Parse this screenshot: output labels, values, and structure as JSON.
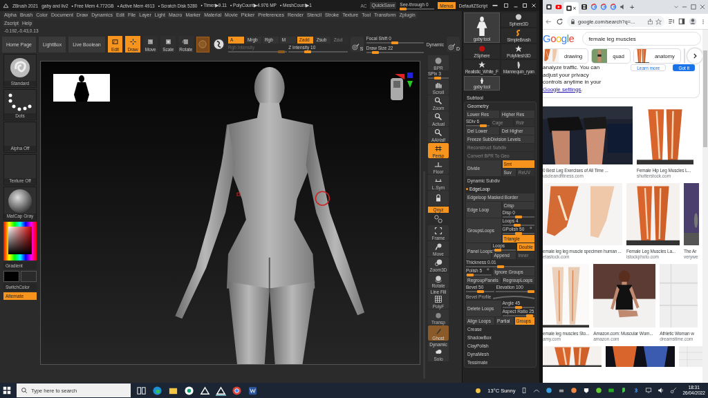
{
  "zbrush": {
    "title_bar": {
      "app": "ZBrush 2021",
      "document": "gaby and liv2",
      "stats": [
        "• Free Mem 4.772GB",
        "• Active Mem 4913",
        "• Scratch Disk 5280",
        "• Timer▶9.11",
        "• PolyCount▶4.976 MP",
        "• MeshCount▶1"
      ],
      "ac": "AC",
      "quicksave": "QuickSave",
      "see_through": {
        "label": "See-through  0",
        "level": 0
      },
      "menus": {
        "label": "Menus",
        "selected": true
      },
      "script": "DefaultZScript"
    },
    "menu_rows": [
      [
        "Alpha",
        "Brush",
        "Color",
        "Document",
        "Draw",
        "Dynamics",
        "Edit",
        "File",
        "Layer",
        "Light",
        "Macro",
        "Marker",
        "Material",
        "Movie",
        "Picker",
        "Preferences",
        "Render",
        "Stencil",
        "Stroke",
        "Texture",
        "Tool",
        "Transform",
        "Zplugin"
      ],
      [
        "Zscript",
        "Help"
      ]
    ],
    "coordinates": "-0.192,-0.43,0.13",
    "toolbar": {
      "buttons": [
        "Home Page",
        "LightBox",
        "Live Boolean"
      ],
      "modes": [
        {
          "label": "Edit",
          "selected": true
        },
        {
          "label": "Draw",
          "selected": true
        },
        {
          "label": "Move",
          "selected": false
        },
        {
          "label": "Scale",
          "selected": false
        },
        {
          "label": "Rotate",
          "selected": false
        }
      ],
      "channels": [
        {
          "label": "A",
          "selected": true,
          "disabled": false
        },
        {
          "label": "Mrgb",
          "selected": false,
          "disabled": false
        },
        {
          "label": "Rgb",
          "selected": false,
          "disabled": false
        },
        {
          "label": "M",
          "selected": false,
          "disabled": false
        }
      ],
      "z_modes": [
        {
          "label": "Zadd",
          "selected": true,
          "disabled": false
        },
        {
          "label": "Zsub",
          "selected": false,
          "disabled": false
        },
        {
          "label": "Zcut",
          "selected": false,
          "disabled": true
        }
      ],
      "intensity": [
        {
          "label": "Rgb Intensity",
          "level": 0.95,
          "disabled": true
        },
        {
          "label": "Z Intensity 10",
          "level": 0.3,
          "disabled": false
        }
      ],
      "s_key": "S",
      "brush_sliders": [
        {
          "label": "Focal Shift 0",
          "level": 0.5,
          "disabled": false
        },
        {
          "label": "Draw Size 22",
          "level": 0.12,
          "disabled": false
        }
      ],
      "dynamic": "Dynamic",
      "d_key": "D"
    },
    "left_shelf": {
      "brush": "Standard",
      "stroke": "Dots",
      "alpha": "Alpha Off",
      "texture": "Texture Off",
      "material": "MatCap Gray",
      "gradient": "Gradient",
      "switch_color": "SwitchColor",
      "alternate": {
        "label": "Alternate",
        "selected": true
      }
    },
    "right_shelf": [
      {
        "kind": "button",
        "label": "BPR",
        "selected": false
      },
      {
        "kind": "slider",
        "label": "SPix 3",
        "level": 0.45
      },
      {
        "kind": "button",
        "label": "Scroll",
        "selected": false
      },
      {
        "kind": "button",
        "label": "Zoom",
        "selected": false
      },
      {
        "kind": "button",
        "label": "Actual",
        "selected": false
      },
      {
        "kind": "button",
        "label": "AAHalf",
        "selected": false
      },
      {
        "kind": "button",
        "label": "Persp",
        "selected": true
      },
      {
        "kind": "button",
        "label": "Floor",
        "selected": false
      },
      {
        "kind": "button",
        "label": "L.Sym",
        "selected": false
      },
      {
        "kind": "icon",
        "selected": false
      },
      {
        "kind": "toggle",
        "label": "Qxyz",
        "selected": true
      },
      {
        "kind": "button",
        "label": "Frame",
        "selected": false
      },
      {
        "kind": "button",
        "label": "Move",
        "selected": false
      },
      {
        "kind": "button",
        "label": "Zoom3D",
        "selected": false
      },
      {
        "kind": "button",
        "label": "Rotate",
        "selected": false
      },
      {
        "kind": "button",
        "label": "PolyF",
        "caption": "Line Fill",
        "selected": false
      },
      {
        "kind": "button",
        "label": "Transp",
        "selected": false
      },
      {
        "kind": "button",
        "label": "Ghost",
        "selected": true
      },
      {
        "kind": "button",
        "label": "Solo",
        "caption": "Dynamic",
        "selected": false
      }
    ],
    "tool_palette": {
      "current_tool": {
        "label": "gaby tool",
        "selected": true
      },
      "tools": [
        {
          "label": "Sphere3D",
          "selected": false
        },
        {
          "label": "SimpleBrush",
          "selected": false
        },
        {
          "label": "ZSphere",
          "selected": false
        },
        {
          "label": "PolyMesh3D",
          "selected": false
        },
        {
          "label": "Realistic_White_F",
          "selected": false
        },
        {
          "label": "Mannequin_ryan",
          "selected": false
        },
        {
          "label": "gaby tool",
          "selected": true
        }
      ],
      "subtool": "Subtool",
      "geometry": {
        "title": "Geometry",
        "blocks": [
          {
            "kind": "row",
            "cells": [
              {
                "kind": "button",
                "label": "Lower Res",
                "selected": false,
                "disabled": false
              },
              {
                "kind": "button",
                "label": "Higher Res",
                "selected": false,
                "disabled": false
              }
            ]
          },
          {
            "kind": "row",
            "cells": [
              {
                "kind": "slider",
                "label": "SDiv 6",
                "level": 0.85
              },
              {
                "kind": "button",
                "label": "Cage",
                "selected": false,
                "disabled": true
              },
              {
                "kind": "button",
                "label": "Rstr",
                "selected": false,
                "disabled": true
              }
            ]
          },
          {
            "kind": "row",
            "cells": [
              {
                "kind": "button",
                "label": "Del Lower",
                "selected": false,
                "disabled": false
              },
              {
                "kind": "button",
                "label": "Del Higher",
                "selected": false,
                "disabled": false
              }
            ]
          },
          {
            "kind": "row",
            "cells": [
              {
                "kind": "button",
                "label": "Freeze SubDivision Levels",
                "selected": false,
                "disabled": false
              }
            ]
          },
          {
            "kind": "row",
            "cells": [
              {
                "kind": "button",
                "label": "Reconstruct Subdiv",
                "selected": false,
                "disabled": true
              }
            ]
          },
          {
            "kind": "row",
            "cells": [
              {
                "kind": "button",
                "label": "Convert BPR To Geo",
                "selected": false,
                "disabled": true
              }
            ]
          },
          {
            "kind": "split",
            "main": {
              "kind": "button",
              "label": "Divide",
              "selected": false,
              "disabled": false
            },
            "side": [
              [
                {
                  "kind": "button",
                  "label": "Smt",
                  "selected": true,
                  "disabled": false
                }
              ],
              [
                {
                  "kind": "button",
                  "label": "Suv",
                  "selected": false,
                  "disabled": false
                },
                {
                  "kind": "button",
                  "label": "ReUV",
                  "selected": false,
                  "disabled": true
                }
              ]
            ]
          },
          {
            "kind": "label",
            "text": "Dynamic Subdiv"
          },
          {
            "kind": "subsection",
            "text": "EdgeLoop"
          },
          {
            "kind": "row",
            "cells": [
              {
                "kind": "button",
                "label": "Edgeloop Masked Border",
                "selected": false,
                "disabled": false
              }
            ]
          },
          {
            "kind": "split",
            "main": {
              "kind": "button",
              "label": "Edge Loop",
              "selected": false,
              "disabled": false
            },
            "side": [
              [
                {
                  "kind": "button",
                  "label": "Crisp",
                  "selected": false,
                  "disabled": false
                }
              ],
              [
                {
                  "kind": "slider",
                  "label": "Disp 0",
                  "level": 0.5
                }
              ]
            ]
          },
          {
            "kind": "split",
            "main": {
              "kind": "button",
              "label": "GroupsLoops",
              "selected": false,
              "disabled": false
            },
            "side": [
              [
                {
                  "kind": "slider",
                  "label": "Loops 4",
                  "level": 0.45
                }
              ],
              [
                {
                  "kind": "slider",
                  "label": "GPolish 50",
                  "level": 0.5,
                  "gear": true
                }
              ],
              [
                {
                  "kind": "button",
                  "label": "Triangle",
                  "selected": true,
                  "disabled": false
                }
              ]
            ]
          },
          {
            "kind": "split",
            "main": {
              "kind": "button",
              "label": "Panel Loops",
              "selected": false,
              "disabled": false
            },
            "side": [
              [
                {
                  "kind": "slider",
                  "label": "Loops",
                  "level": 0.1
                },
                {
                  "kind": "button",
                  "label": "Double",
                  "selected": true,
                  "disabled": false
                }
              ],
              [
                {
                  "kind": "button",
                  "label": "Append",
                  "selected": false,
                  "disabled": false
                },
                {
                  "kind": "button",
                  "label": "Inner",
                  "selected": false,
                  "disabled": true
                }
              ]
            ]
          },
          {
            "kind": "row",
            "cells": [
              {
                "kind": "slider",
                "label": "Thickness 0.01",
                "level": 0.5
              }
            ]
          },
          {
            "kind": "row",
            "cells": [
              {
                "kind": "slider",
                "label": "Polish 5",
                "level": 0.05,
                "gear": true
              },
              {
                "kind": "button",
                "label": "Ignore Groups",
                "selected": false,
                "disabled": false
              }
            ]
          },
          {
            "kind": "row",
            "cells": [
              {
                "kind": "button",
                "label": "RegroupPanels",
                "selected": false,
                "disabled": false
              },
              {
                "kind": "button",
                "label": "RegroupLoops",
                "selected": false,
                "disabled": false
              }
            ]
          },
          {
            "kind": "row",
            "cells": [
              {
                "kind": "slider",
                "label": "Bevel 50",
                "level": 0.5
              },
              {
                "kind": "slider",
                "label": "Elevation 100",
                "level": 1
              }
            ]
          },
          {
            "kind": "curve",
            "text": "Bevel Profile"
          },
          {
            "kind": "split",
            "main": {
              "kind": "button",
              "label": "Delete Loops",
              "selected": false,
              "disabled": false
            },
            "side": [
              [
                {
                  "kind": "slider",
                  "label": "Angle 45",
                  "level": 0.5
                }
              ],
              [
                {
                  "kind": "slider",
                  "label": "Aspect Ratio 25",
                  "level": 0.95
                }
              ]
            ]
          },
          {
            "kind": "row",
            "cells": [
              {
                "kind": "button",
                "label": "Align Loops",
                "selected": false,
                "disabled": false
              },
              {
                "kind": "button",
                "label": "Partial",
                "selected": false,
                "disabled": false
              },
              {
                "kind": "button",
                "label": "Groups",
                "selected": true,
                "disabled": false
              }
            ]
          },
          {
            "kind": "label",
            "text": "Crease"
          },
          {
            "kind": "label",
            "text": "ShadowBox"
          },
          {
            "kind": "label",
            "text": "ClayPolish"
          },
          {
            "kind": "label",
            "text": "DynaMesh"
          },
          {
            "kind": "label",
            "text": "Tessimate"
          }
        ]
      }
    }
  },
  "browser": {
    "tabs": [
      {
        "kind": "page",
        "selected": false
      },
      {
        "kind": "video",
        "selected": false
      },
      {
        "kind": "page",
        "selected": true,
        "close": "×"
      },
      {
        "kind": "dark",
        "selected": false
      },
      {
        "kind": "google",
        "selected": false
      },
      {
        "kind": "google",
        "selected": false
      },
      {
        "kind": "google",
        "selected": false
      },
      {
        "kind": "audio",
        "selected": false
      }
    ],
    "new_tab": "+",
    "url": "google.com/search?q=...",
    "logo": "Google",
    "query": "female leg muscles",
    "chips": [
      {
        "label": "drawing"
      },
      {
        "label": "quad"
      },
      {
        "label": "anatomy"
      },
      {
        "kind": "picture"
      }
    ],
    "notice": {
      "text": "analyze traffic. You can adjust your privacy controls anytime in your ",
      "link": "Google settings",
      "end": ".",
      "buttons": [
        "Learn more",
        "Got it"
      ]
    },
    "results": [
      [
        {
          "title": "0 Best Leg Exercises of All Time ...",
          "source": "uscleandfitness.com"
        },
        {
          "title": "Female Hip Leg Muscles L...",
          "source": "shutterstock.com"
        }
      ],
      [
        {
          "title": "emale leg leg muscle specimen human ...",
          "source": "etastock.com"
        },
        {
          "title": "Female Leg Muscles La...",
          "source": "istockphoto.com"
        },
        {
          "title": "The Ar",
          "source": "verywe"
        }
      ],
      [
        {
          "title": "emale leg muscles Sto...",
          "source": "amy.com"
        },
        {
          "title": "Amazon.com: Muscular Wom...",
          "source": "amazon.com"
        },
        {
          "title": "Athletic Woman w",
          "source": "dreamstime.com"
        }
      ],
      [
        {
          "kind": "picture"
        },
        {
          "kind": "picture"
        },
        {
          "kind": "picture"
        }
      ]
    ]
  },
  "taskbar": {
    "search": "Type here to search",
    "weather": "13°C  Sunny",
    "time": "18:31",
    "date": "26/04/2022"
  }
}
